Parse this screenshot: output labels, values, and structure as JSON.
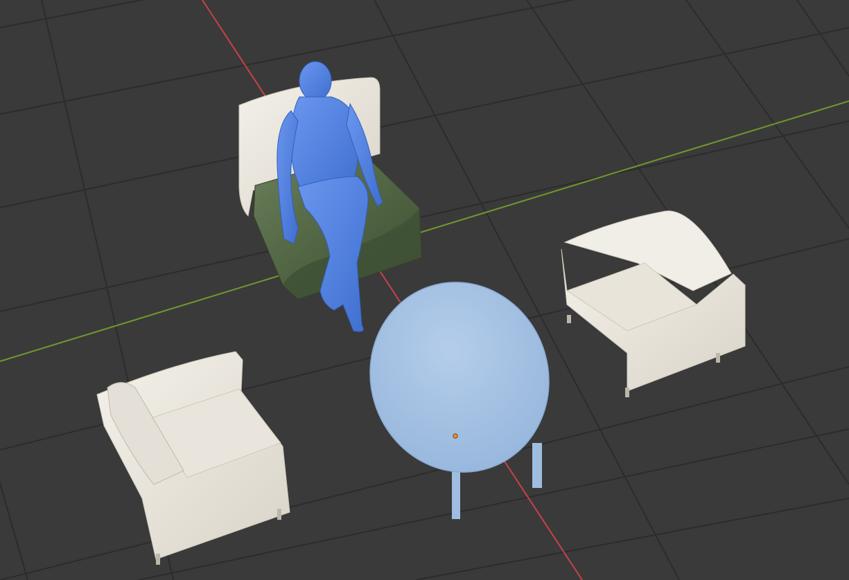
{
  "viewport": {
    "view": "perspective",
    "background_color": "#3a3a3a",
    "grid_color": "#2b2b2b",
    "axis_x_color": "#c8414b",
    "axis_y_color": "#6f9a2f",
    "selection_highlight_color": "#a7c4e6",
    "origin_marker_color": "#f28c28"
  },
  "objects": [
    {
      "id": "human",
      "kind": "human-figure",
      "color": "#5b86e3",
      "selected": false
    },
    {
      "id": "sofa_chair_green",
      "kind": "single-sofa",
      "seat_color": "#56684a",
      "back_color": "#e9e3d2"
    },
    {
      "id": "armchair_right",
      "kind": "armchair",
      "color": "#ece8df"
    },
    {
      "id": "armchair_left",
      "kind": "armchair",
      "color": "#ece8df"
    },
    {
      "id": "table",
      "kind": "oval-table",
      "color": "#a7c4e6",
      "selected": true
    }
  ]
}
